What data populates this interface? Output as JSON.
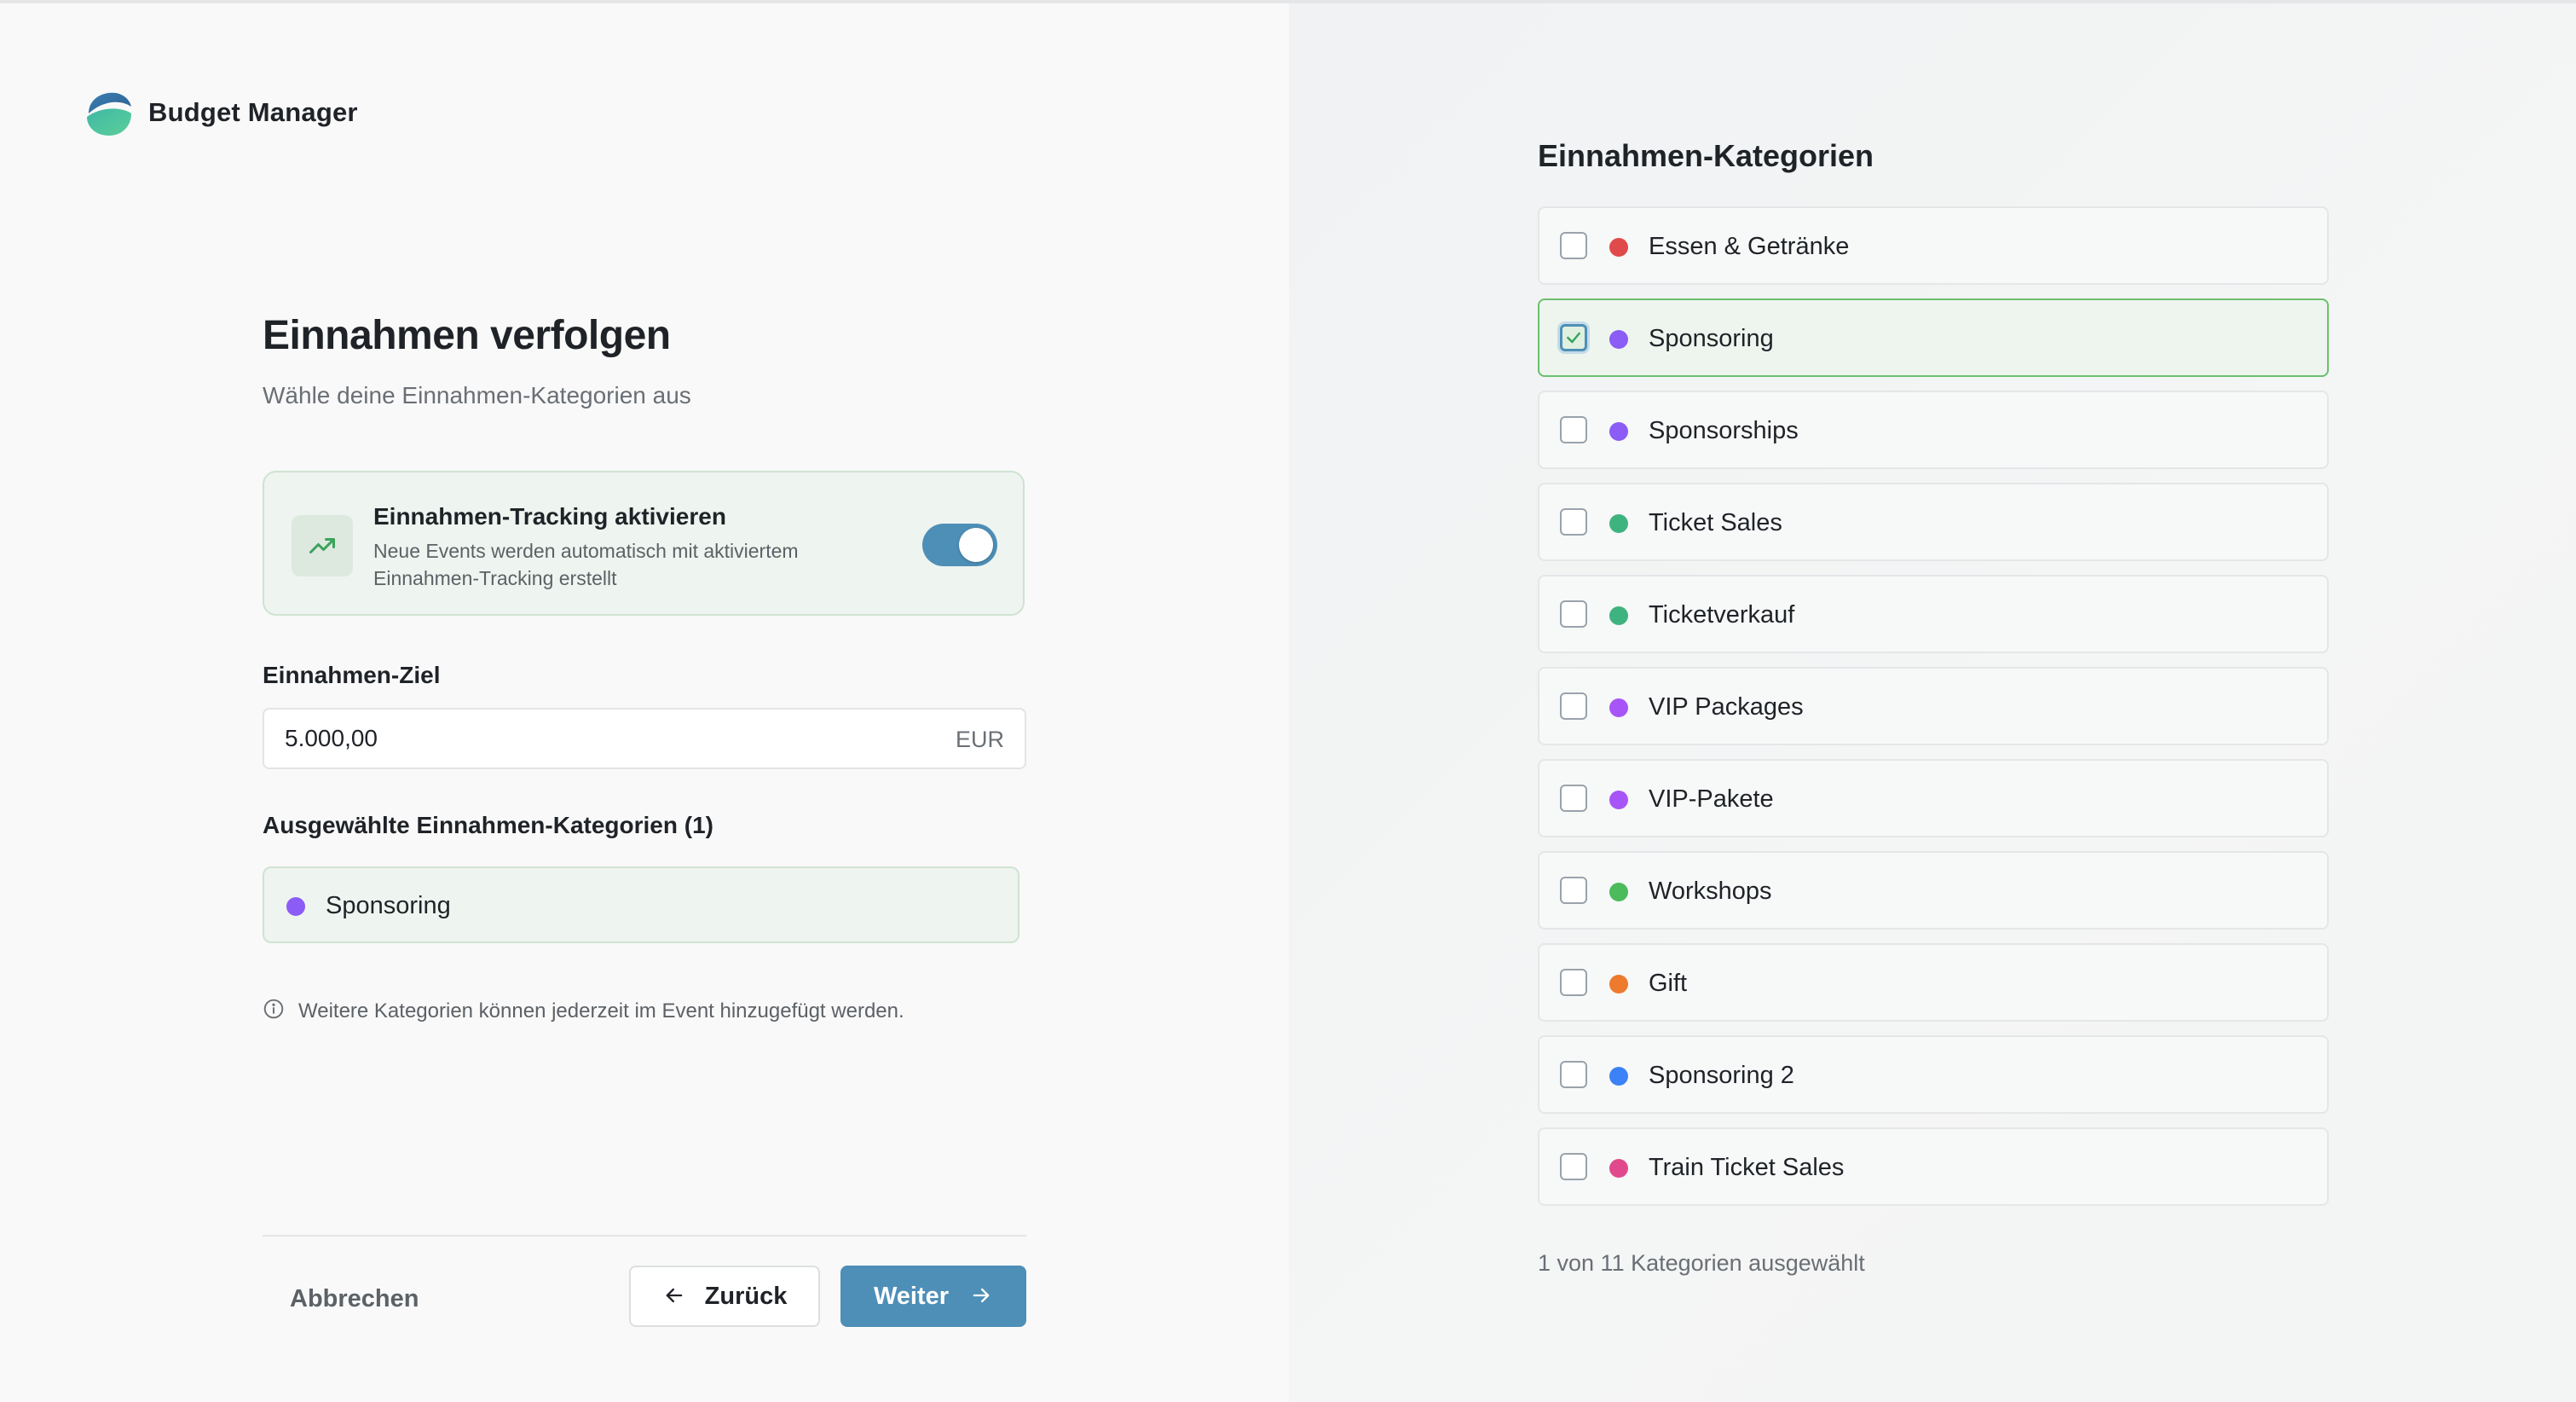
{
  "app": {
    "name": "Budget Manager"
  },
  "page": {
    "title": "Einnahmen verfolgen",
    "subtitle": "Wähle deine Einnahmen-Kategorien aus"
  },
  "tracking": {
    "title": "Einnahmen-Tracking aktivieren",
    "description": "Neue Events werden automatisch mit aktiviertem Einnahmen-Tracking erstellt",
    "enabled": true,
    "icon": "trending-up-icon"
  },
  "goal": {
    "label": "Einnahmen-Ziel",
    "value": "5.000,00",
    "currency": "EUR"
  },
  "selected": {
    "label": "Ausgewählte Einnahmen-Kategorien (1)",
    "items": [
      {
        "label": "Sponsoring",
        "color": "#8b5cf6"
      }
    ]
  },
  "info": {
    "text": "Weitere Kategorien können jederzeit im Event hinzugefügt werden.",
    "icon": "info-icon"
  },
  "footer": {
    "cancel": "Abbrechen",
    "back": "Zurück",
    "next": "Weiter"
  },
  "categories": {
    "title": "Einnahmen-Kategorien",
    "items": [
      {
        "label": "Essen & Getränke",
        "color": "#e04a4a",
        "checked": false
      },
      {
        "label": "Sponsoring",
        "color": "#8b5cf6",
        "checked": true
      },
      {
        "label": "Sponsorships",
        "color": "#8b5cf6",
        "checked": false
      },
      {
        "label": "Ticket Sales",
        "color": "#3fb37f",
        "checked": false
      },
      {
        "label": "Ticketverkauf",
        "color": "#3fb37f",
        "checked": false
      },
      {
        "label": "VIP Packages",
        "color": "#a855f7",
        "checked": false
      },
      {
        "label": "VIP-Pakete",
        "color": "#a855f7",
        "checked": false
      },
      {
        "label": "Workshops",
        "color": "#4cbb5c",
        "checked": false
      },
      {
        "label": "Gift",
        "color": "#ee7a2e",
        "checked": false
      },
      {
        "label": "Sponsoring 2",
        "color": "#3b82f6",
        "checked": false
      },
      {
        "label": "Train Ticket Sales",
        "color": "#e04a8c",
        "checked": false
      }
    ],
    "count_text": "1 von 11 Kategorien ausgewählt"
  }
}
